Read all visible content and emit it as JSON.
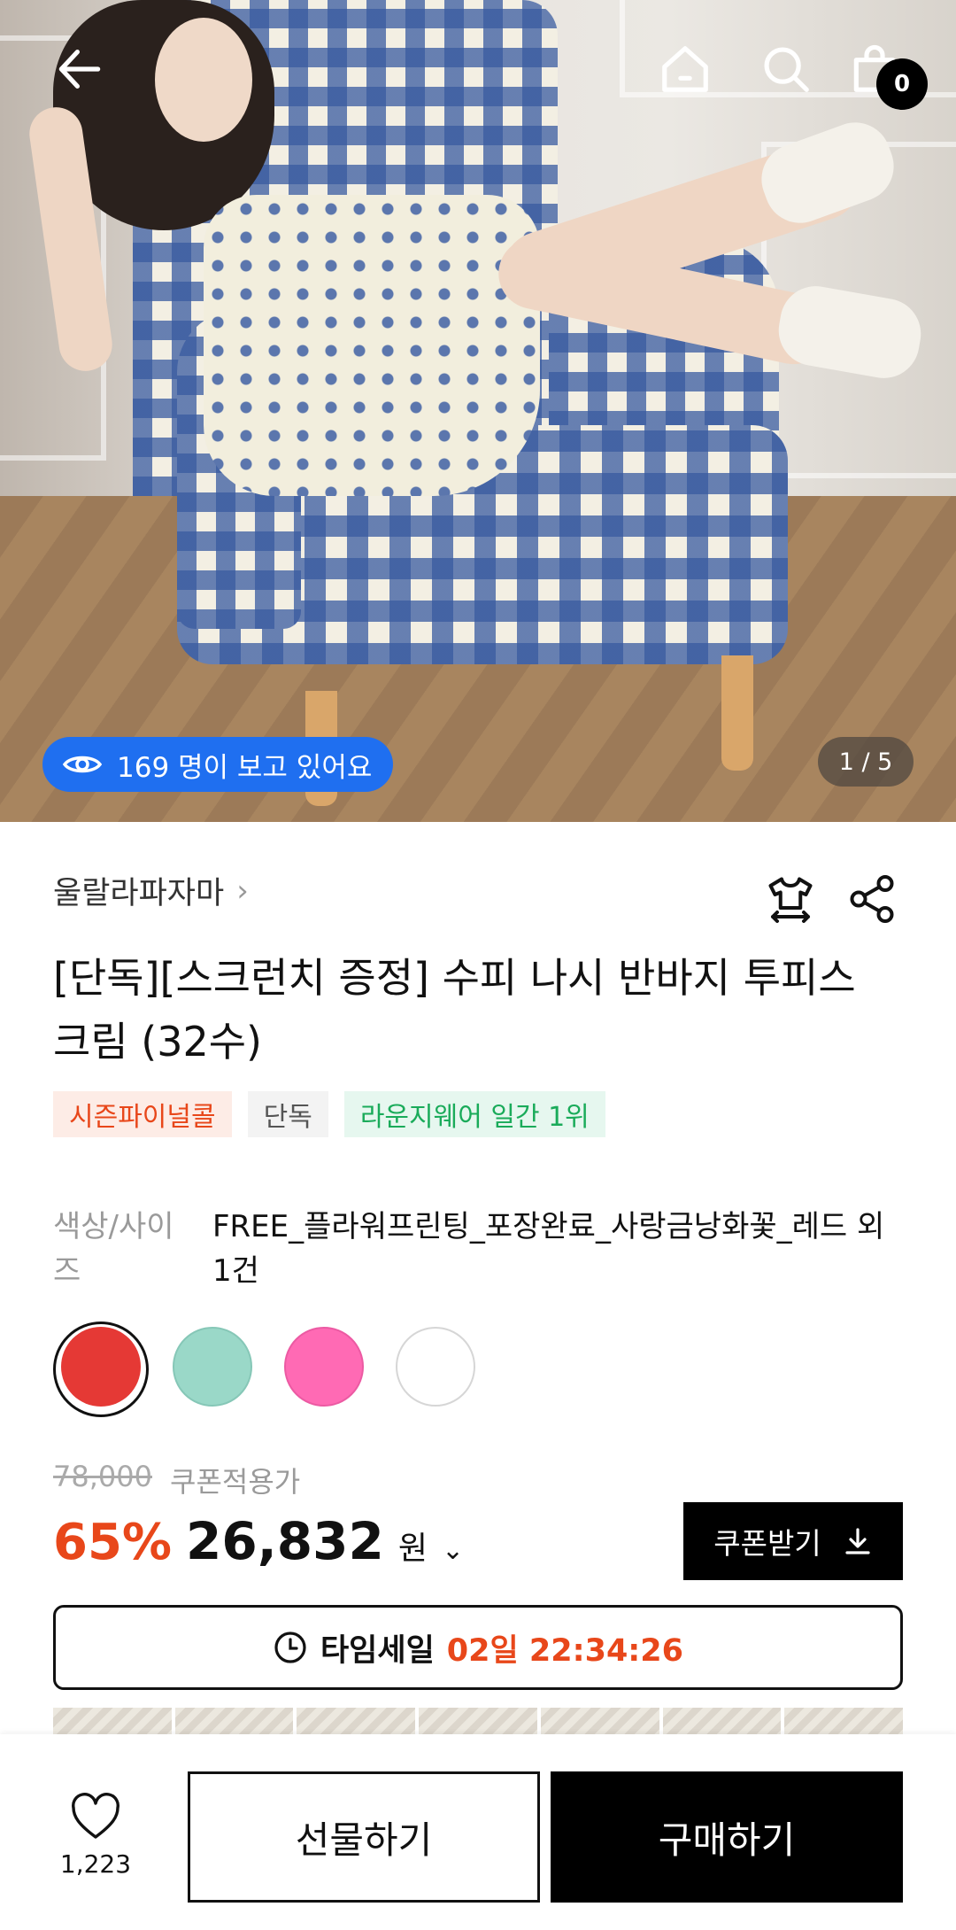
{
  "hero": {
    "viewers_text": "169 명이 보고 있어요",
    "image_counter": "1 / 5",
    "cart_count": "0"
  },
  "product": {
    "brand": "울랄라파자마",
    "title": "[단독][스크런치 증정] 수피 나시 반바지 투피스 크림 (32수)",
    "tags": [
      {
        "label": "시즌파이널콜",
        "style": "red"
      },
      {
        "label": "단독",
        "style": "gray"
      },
      {
        "label": "라운지웨어 일간 1위",
        "style": "green"
      }
    ],
    "option_label": "색상/사이즈",
    "option_value": "FREE_플라워프린팅_포장완료_사랑금낭화꽃_레드 외 1건",
    "swatches": [
      {
        "color": "#e53935",
        "selected": true
      },
      {
        "color": "#9ad8c8",
        "selected": false
      },
      {
        "color": "#ff6ab4",
        "selected": false
      },
      {
        "color": "#ffffff",
        "selected": false
      }
    ]
  },
  "pricing": {
    "original_price": "78,000",
    "coupon_note": "쿠폰적용가",
    "discount": "65%",
    "price": "26,832",
    "currency": "원",
    "coupon_button": "쿠폰받기"
  },
  "timesale": {
    "label": "타임세일",
    "countdown": "02일 22:34:26"
  },
  "bottom": {
    "like_count": "1,223",
    "gift_button": "선물하기",
    "buy_button": "구매하기"
  },
  "colors": {
    "accent": "#e8471a",
    "viewer_badge": "#1f6ff0",
    "primary_button": "#000000"
  }
}
